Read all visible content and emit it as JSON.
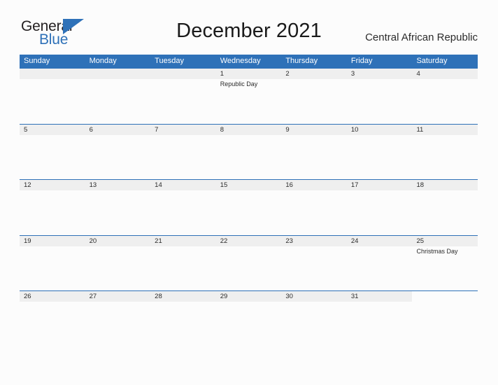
{
  "brand": {
    "name_part1": "General",
    "name_part2": "Blue",
    "triangle_icon": "triangle-icon",
    "color_dark": "#231f20",
    "color_blue": "#2e71b8"
  },
  "header": {
    "title": "December 2021",
    "country": "Central African Republic"
  },
  "theme": {
    "header_blue": "#2e71b8",
    "row_band_gray": "#efefef",
    "page_background": "#fcfcfc",
    "text_color": "#2b2b2b"
  },
  "calendar": {
    "month": "December",
    "year": "2021",
    "weekday_headers": [
      "Sunday",
      "Monday",
      "Tuesday",
      "Wednesday",
      "Thursday",
      "Friday",
      "Saturday"
    ],
    "weeks": [
      [
        {
          "date": "",
          "event": ""
        },
        {
          "date": "",
          "event": ""
        },
        {
          "date": "",
          "event": ""
        },
        {
          "date": "1",
          "event": "Republic Day"
        },
        {
          "date": "2",
          "event": ""
        },
        {
          "date": "3",
          "event": ""
        },
        {
          "date": "4",
          "event": ""
        }
      ],
      [
        {
          "date": "5",
          "event": ""
        },
        {
          "date": "6",
          "event": ""
        },
        {
          "date": "7",
          "event": ""
        },
        {
          "date": "8",
          "event": ""
        },
        {
          "date": "9",
          "event": ""
        },
        {
          "date": "10",
          "event": ""
        },
        {
          "date": "11",
          "event": ""
        }
      ],
      [
        {
          "date": "12",
          "event": ""
        },
        {
          "date": "13",
          "event": ""
        },
        {
          "date": "14",
          "event": ""
        },
        {
          "date": "15",
          "event": ""
        },
        {
          "date": "16",
          "event": ""
        },
        {
          "date": "17",
          "event": ""
        },
        {
          "date": "18",
          "event": ""
        }
      ],
      [
        {
          "date": "19",
          "event": ""
        },
        {
          "date": "20",
          "event": ""
        },
        {
          "date": "21",
          "event": ""
        },
        {
          "date": "22",
          "event": ""
        },
        {
          "date": "23",
          "event": ""
        },
        {
          "date": "24",
          "event": ""
        },
        {
          "date": "25",
          "event": "Christmas Day"
        }
      ],
      [
        {
          "date": "26",
          "event": ""
        },
        {
          "date": "27",
          "event": ""
        },
        {
          "date": "28",
          "event": ""
        },
        {
          "date": "29",
          "event": ""
        },
        {
          "date": "30",
          "event": ""
        },
        {
          "date": "31",
          "event": ""
        },
        {
          "date": "",
          "event": ""
        }
      ]
    ]
  }
}
